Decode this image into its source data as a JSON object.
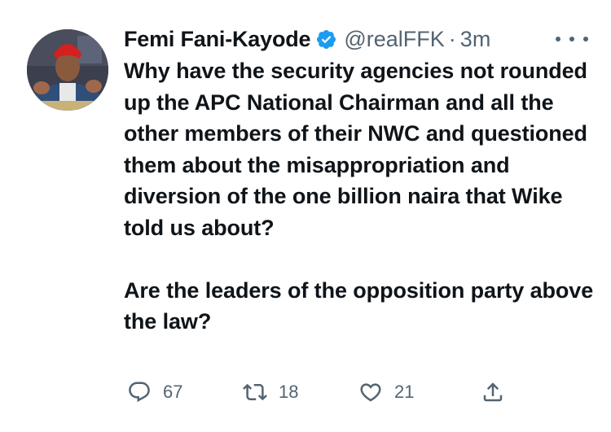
{
  "author": {
    "display_name": "Femi Fani-Kayode",
    "handle": "@realFFK",
    "separator": "·",
    "time_ago": "3m",
    "verified": true
  },
  "tweet": {
    "paragraph1": "Why have the security agencies not rounded up the APC National Chairman and all the other members of their NWC and questioned them about the misappropriation and diversion of the one billion naira that Wike told us about?",
    "paragraph2": "Are the leaders of the opposition party above the law?"
  },
  "actions": {
    "replies": "67",
    "retweets": "18",
    "likes": "21"
  },
  "colors": {
    "verified_badge": "#1d9bf0",
    "secondary_text": "#536471",
    "primary_text": "#0f1419"
  },
  "icons": {
    "reply": "reply-icon",
    "retweet": "retweet-icon",
    "like": "heart-icon",
    "share": "share-icon",
    "more": "more-icon"
  }
}
